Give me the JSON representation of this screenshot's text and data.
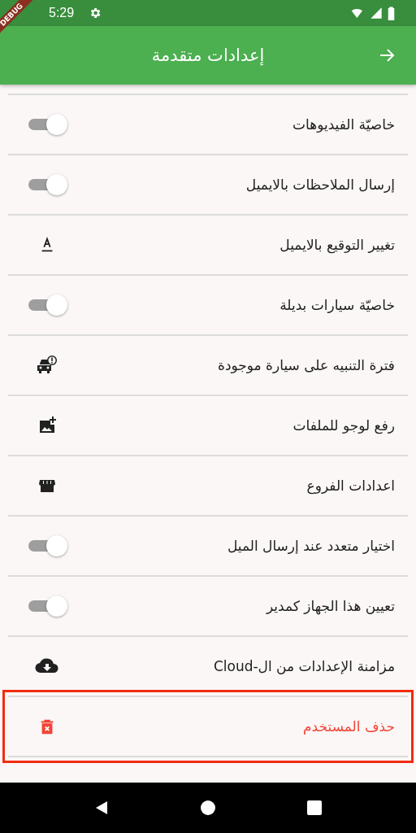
{
  "status_bar": {
    "time": "5:29"
  },
  "debug_banner": "DEBUG",
  "app_bar": {
    "title": "إعدادات متقدمة"
  },
  "items": [
    {
      "kind": "switch",
      "label": "خاصيّة الفيديوهات",
      "on": false,
      "color": "#212121",
      "highlighted": false
    },
    {
      "kind": "switch",
      "label": "إرسال الملاحظات بالايميل",
      "on": false,
      "color": "#212121",
      "highlighted": false
    },
    {
      "kind": "signature",
      "label": "تغيير التوقيع بالايميل",
      "color": "#212121",
      "highlighted": false
    },
    {
      "kind": "switch",
      "label": "خاصيّة سيارات بديلة",
      "on": false,
      "color": "#212121",
      "highlighted": false
    },
    {
      "kind": "car-alert",
      "label": "فترة التنبيه على سيارة موجودة",
      "color": "#212121",
      "highlighted": false
    },
    {
      "kind": "add-image",
      "label": "رفع لوجو للملفات",
      "color": "#212121",
      "highlighted": false
    },
    {
      "kind": "store",
      "label": "اعدادات الفروع",
      "color": "#212121",
      "highlighted": false
    },
    {
      "kind": "switch",
      "label": "اختيار متعدد عند إرسال الميل",
      "on": false,
      "color": "#212121",
      "highlighted": false
    },
    {
      "kind": "switch",
      "label": "تعيين هذا الجهاز كمدير",
      "on": false,
      "color": "#212121",
      "highlighted": false
    },
    {
      "kind": "cloud-download",
      "label": "مزامنة الإعدادات من ال-Cloud",
      "color": "#212121",
      "highlighted": false
    },
    {
      "kind": "delete",
      "label": "حذف المستخدم",
      "color": "#f44336",
      "highlighted": true
    }
  ]
}
